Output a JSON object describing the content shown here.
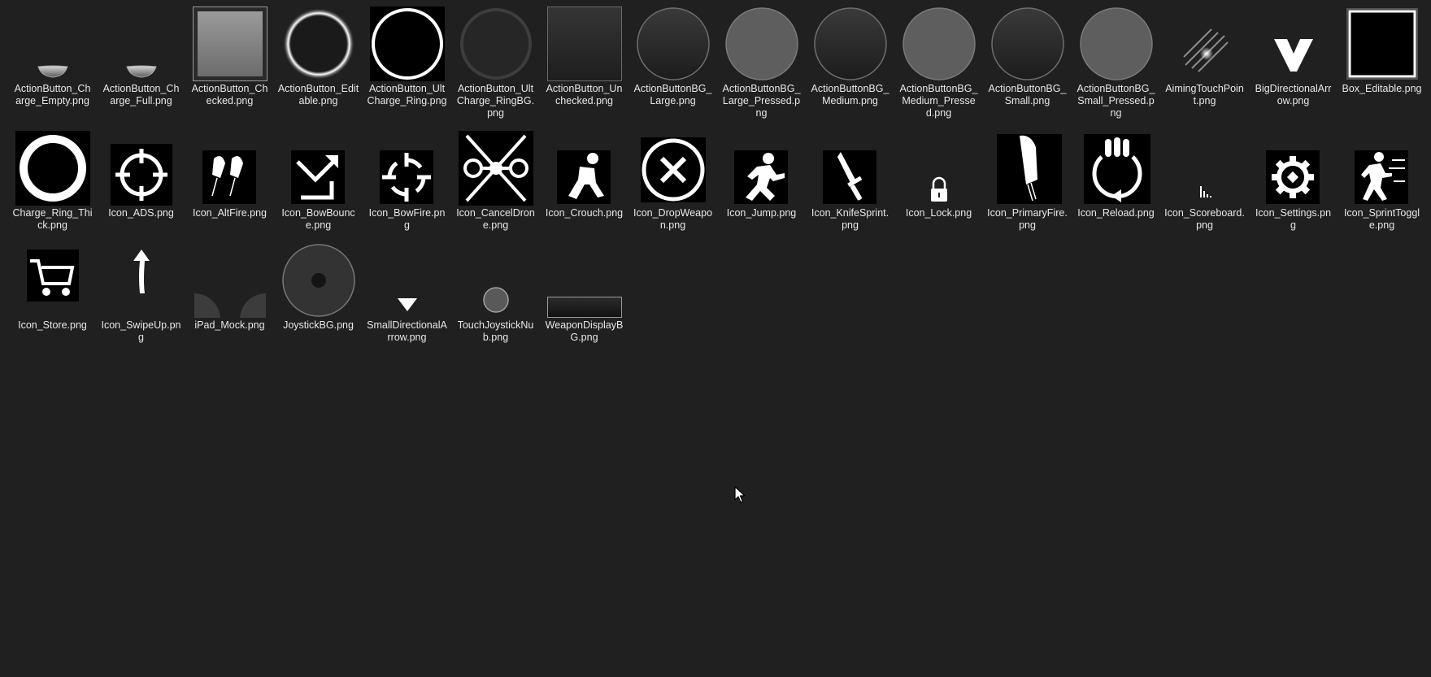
{
  "window": {
    "background": "#202020",
    "text_color": "#e8e8e8"
  },
  "files": [
    {
      "name": "ActionButton_Charge_Empty.png",
      "icon": "small-bowl-icon"
    },
    {
      "name": "ActionButton_Charge_Full.png",
      "icon": "small-bowl-icon"
    },
    {
      "name": "ActionButton_Checked.png",
      "icon": "gray-square-icon"
    },
    {
      "name": "ActionButton_Editable.png",
      "icon": "glow-ring-icon"
    },
    {
      "name": "ActionButton_UltCharge_Ring.png",
      "icon": "white-ring-icon"
    },
    {
      "name": "ActionButton_UltCharge_RingBG.png",
      "icon": "dark-ring-icon"
    },
    {
      "name": "ActionButton_Unchecked.png",
      "icon": "dark-square-icon"
    },
    {
      "name": "ActionButtonBG_Large.png",
      "icon": "dark-circle-icon"
    },
    {
      "name": "ActionButtonBG_Large_Pressed.png",
      "icon": "gray-circle-icon"
    },
    {
      "name": "ActionButtonBG_Medium.png",
      "icon": "dark-circle-icon"
    },
    {
      "name": "ActionButtonBG_Medium_Pressed.png",
      "icon": "gray-circle-icon"
    },
    {
      "name": "ActionButtonBG_Small.png",
      "icon": "dark-circle-icon"
    },
    {
      "name": "ActionButtonBG_Small_Pressed.png",
      "icon": "gray-circle-icon"
    },
    {
      "name": "AimingTouchPoint.png",
      "icon": "aiming-streak-icon"
    },
    {
      "name": "BigDirectionalArrow.png",
      "icon": "chevron-down-icon"
    },
    {
      "name": "Box_Editable.png",
      "icon": "glow-square-icon"
    },
    {
      "name": "Charge_Ring_Thick.png",
      "icon": "thick-ring-icon"
    },
    {
      "name": "Icon_ADS.png",
      "icon": "crosshair-icon"
    },
    {
      "name": "Icon_AltFire.png",
      "icon": "double-bullet-icon"
    },
    {
      "name": "Icon_BowBounce.png",
      "icon": "bow-bounce-icon"
    },
    {
      "name": "Icon_BowFire.png",
      "icon": "bow-fire-reticle-icon"
    },
    {
      "name": "Icon_CancelDrone.png",
      "icon": "cancel-drone-icon"
    },
    {
      "name": "Icon_Crouch.png",
      "icon": "crouch-figure-icon"
    },
    {
      "name": "Icon_DropWeapon.png",
      "icon": "circle-x-icon"
    },
    {
      "name": "Icon_Jump.png",
      "icon": "running-figure-icon"
    },
    {
      "name": "Icon_KnifeSprint.png",
      "icon": "knife-icon"
    },
    {
      "name": "Icon_Lock.png",
      "icon": "lock-icon"
    },
    {
      "name": "Icon_PrimaryFire.png",
      "icon": "bullet-icon"
    },
    {
      "name": "Icon_Reload.png",
      "icon": "reload-icon"
    },
    {
      "name": "Icon_Scoreboard.png",
      "icon": "scoreboard-icon"
    },
    {
      "name": "Icon_Settings.png",
      "icon": "gear-icon"
    },
    {
      "name": "Icon_SprintToggle.png",
      "icon": "sprint-figure-icon"
    },
    {
      "name": "Icon_Store.png",
      "icon": "cart-icon"
    },
    {
      "name": "Icon_SwipeUp.png",
      "icon": "arrow-up-icon"
    },
    {
      "name": "iPad_Mock.png",
      "icon": "ipad-mock-icon"
    },
    {
      "name": "JoystickBG.png",
      "icon": "joystick-bg-icon"
    },
    {
      "name": "SmallDirectionalArrow.png",
      "icon": "triangle-down-icon"
    },
    {
      "name": "TouchJoystickNub.png",
      "icon": "joystick-nub-icon"
    },
    {
      "name": "WeaponDisplayBG.png",
      "icon": "weapon-bar-icon"
    }
  ]
}
